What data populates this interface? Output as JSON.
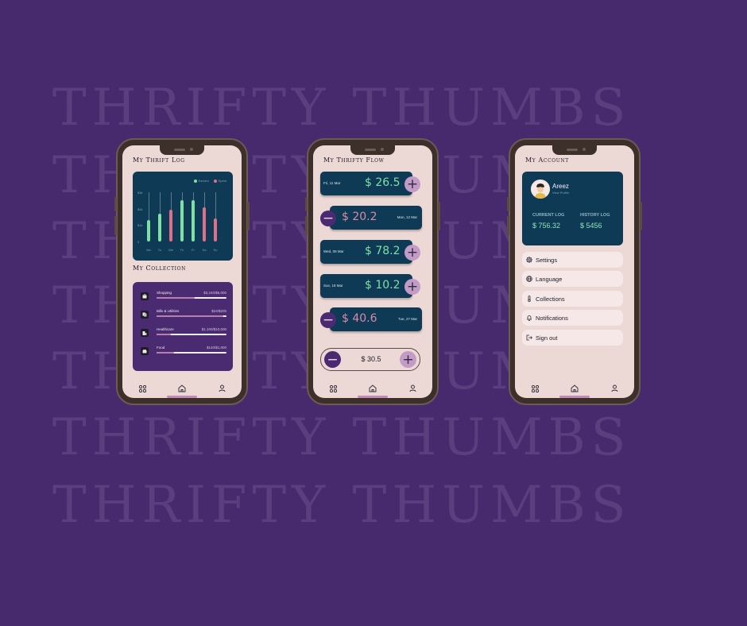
{
  "background": {
    "watermark": "THRIFTY THUMBS",
    "color": "#472a6e"
  },
  "screen_log": {
    "title": "My Thrift Log",
    "legend": {
      "earned": "Earned",
      "spent": "Spent"
    },
    "chart_data": {
      "type": "bar",
      "categories": [
        "Mo",
        "Tu",
        "We",
        "Th",
        "Fr",
        "Sa",
        "Su"
      ],
      "yticks": [
        "$3k",
        "$2k",
        "$1k",
        "0"
      ],
      "ylim": [
        0,
        3
      ],
      "series": [
        {
          "name": "Earned",
          "color": "#7ee0a3",
          "values": [
            1.3,
            1.7,
            null,
            2.5,
            2.5,
            null,
            null
          ]
        },
        {
          "name": "Spent",
          "color": "#e06f8a",
          "values": [
            null,
            null,
            1.95,
            null,
            null,
            2.1,
            1.4
          ]
        }
      ]
    },
    "collection_title": "My Collection",
    "collection": [
      {
        "name": "Shopping",
        "amount": "$3,240/$6,000",
        "fill": 0.54,
        "icon": "shopping-icon"
      },
      {
        "name": "Bills & Utilities",
        "amount": "$24/$200",
        "fill": 0.96,
        "icon": "bills-icon"
      },
      {
        "name": "Healthcare",
        "amount": "$1,100/$10,000",
        "fill": 0.2,
        "icon": "healthcare-icon"
      },
      {
        "name": "Food",
        "amount": "$140/$1,000",
        "fill": 0.25,
        "icon": "food-icon"
      }
    ]
  },
  "screen_flow": {
    "title": "My Thrifty Flow",
    "entries": [
      {
        "date": "Fri, 11 Mar",
        "amount": "$ 26.5",
        "type": "earned"
      },
      {
        "date": "Mon, 12 Mar",
        "amount": "$ 20.2",
        "type": "spent"
      },
      {
        "date": "Wed, 08 Mar",
        "amount": "$ 78.2",
        "type": "earned"
      },
      {
        "date": "Sun, 18 Mar",
        "amount": "$ 10.2",
        "type": "earned"
      },
      {
        "date": "Tue, 27 Mar",
        "amount": "$ 40.6",
        "type": "spent"
      }
    ],
    "input_value": "$ 30.5",
    "colors": {
      "earned": "#7ee0a3",
      "spent": "#d98aa9"
    }
  },
  "screen_account": {
    "title": "My Account",
    "name": "Areez",
    "subtitle": "View Profile",
    "current_log_label": "CURRENT LOG",
    "current_log_value": "$ 756.32",
    "history_log_label": "HISTORY LOG",
    "history_log_value": "$ 5456",
    "menu": [
      {
        "label": "Settings",
        "icon": "gear-icon"
      },
      {
        "label": "Language",
        "icon": "globe-icon"
      },
      {
        "label": "Collections",
        "icon": "thermometer-icon"
      },
      {
        "label": "Notifications",
        "icon": "bell-icon"
      },
      {
        "label": "Sign out",
        "icon": "sign-out-icon"
      }
    ]
  },
  "nav": {
    "icons": [
      "grid-icon",
      "home-icon",
      "user-icon"
    ]
  }
}
